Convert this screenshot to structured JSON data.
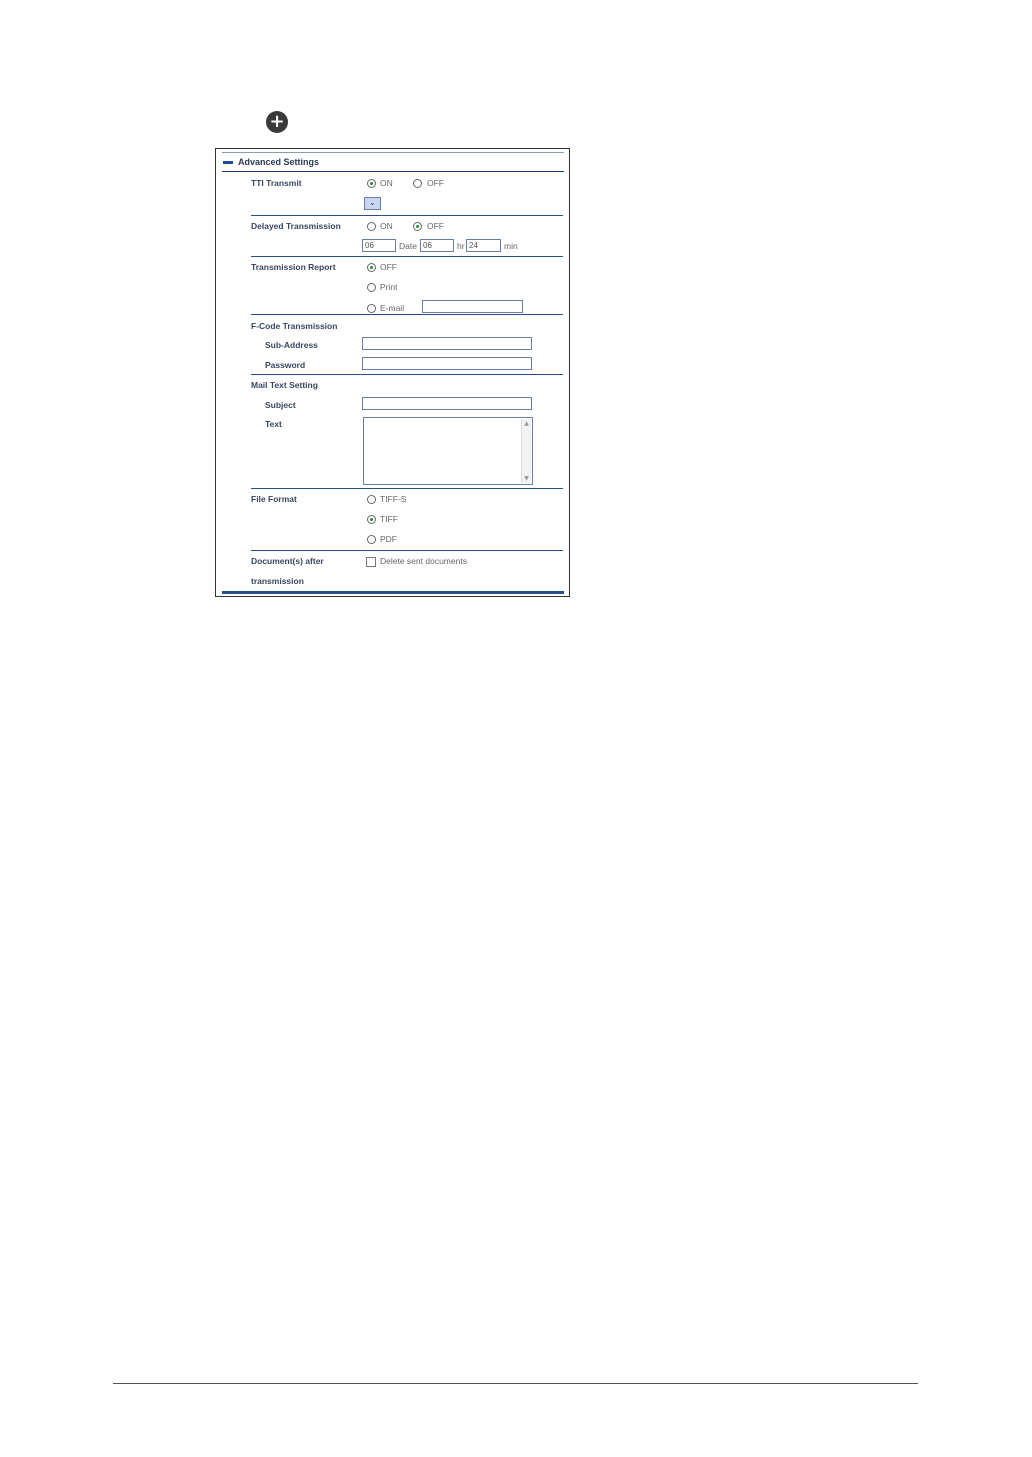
{
  "expand_button": {
    "icon": "plus-circle-icon"
  },
  "panel": {
    "title": "Advanced Settings",
    "tti_transmit": {
      "label": "TTI Transmit",
      "on": "ON",
      "off": "OFF",
      "selected": "ON"
    },
    "delayed_transmission": {
      "label": "Delayed Transmission",
      "on": "ON",
      "off": "OFF",
      "selected": "OFF",
      "date_value": "06",
      "date_label": "Date",
      "hr_value": "06",
      "hr_label": "hr",
      "min_value": "24",
      "min_label": "min"
    },
    "transmission_report": {
      "label": "Transmission Report",
      "off": "OFF",
      "print": "Print",
      "email": "E-mail",
      "email_value": "",
      "selected": "OFF"
    },
    "fcode": {
      "label": "F-Code Transmission",
      "sub_address_label": "Sub-Address",
      "sub_address_value": "",
      "password_label": "Password",
      "password_value": ""
    },
    "mail_text": {
      "label": "Mail Text Setting",
      "subject_label": "Subject",
      "subject_value": "",
      "text_label": "Text"
    },
    "file_format": {
      "label": "File Format",
      "tiff_s": "TIFF-S",
      "tiff": "TIFF",
      "pdf": "PDF",
      "selected": "TIFF"
    },
    "documents_after": {
      "label_line1": "Document(s) after",
      "label_line2": "transmission",
      "checkbox_label": "Delete sent documents",
      "checked": false
    }
  },
  "colors": {
    "accent": "#1f4a96",
    "selected_radio": "#2e8b3a",
    "border": "#6a7ea4"
  }
}
